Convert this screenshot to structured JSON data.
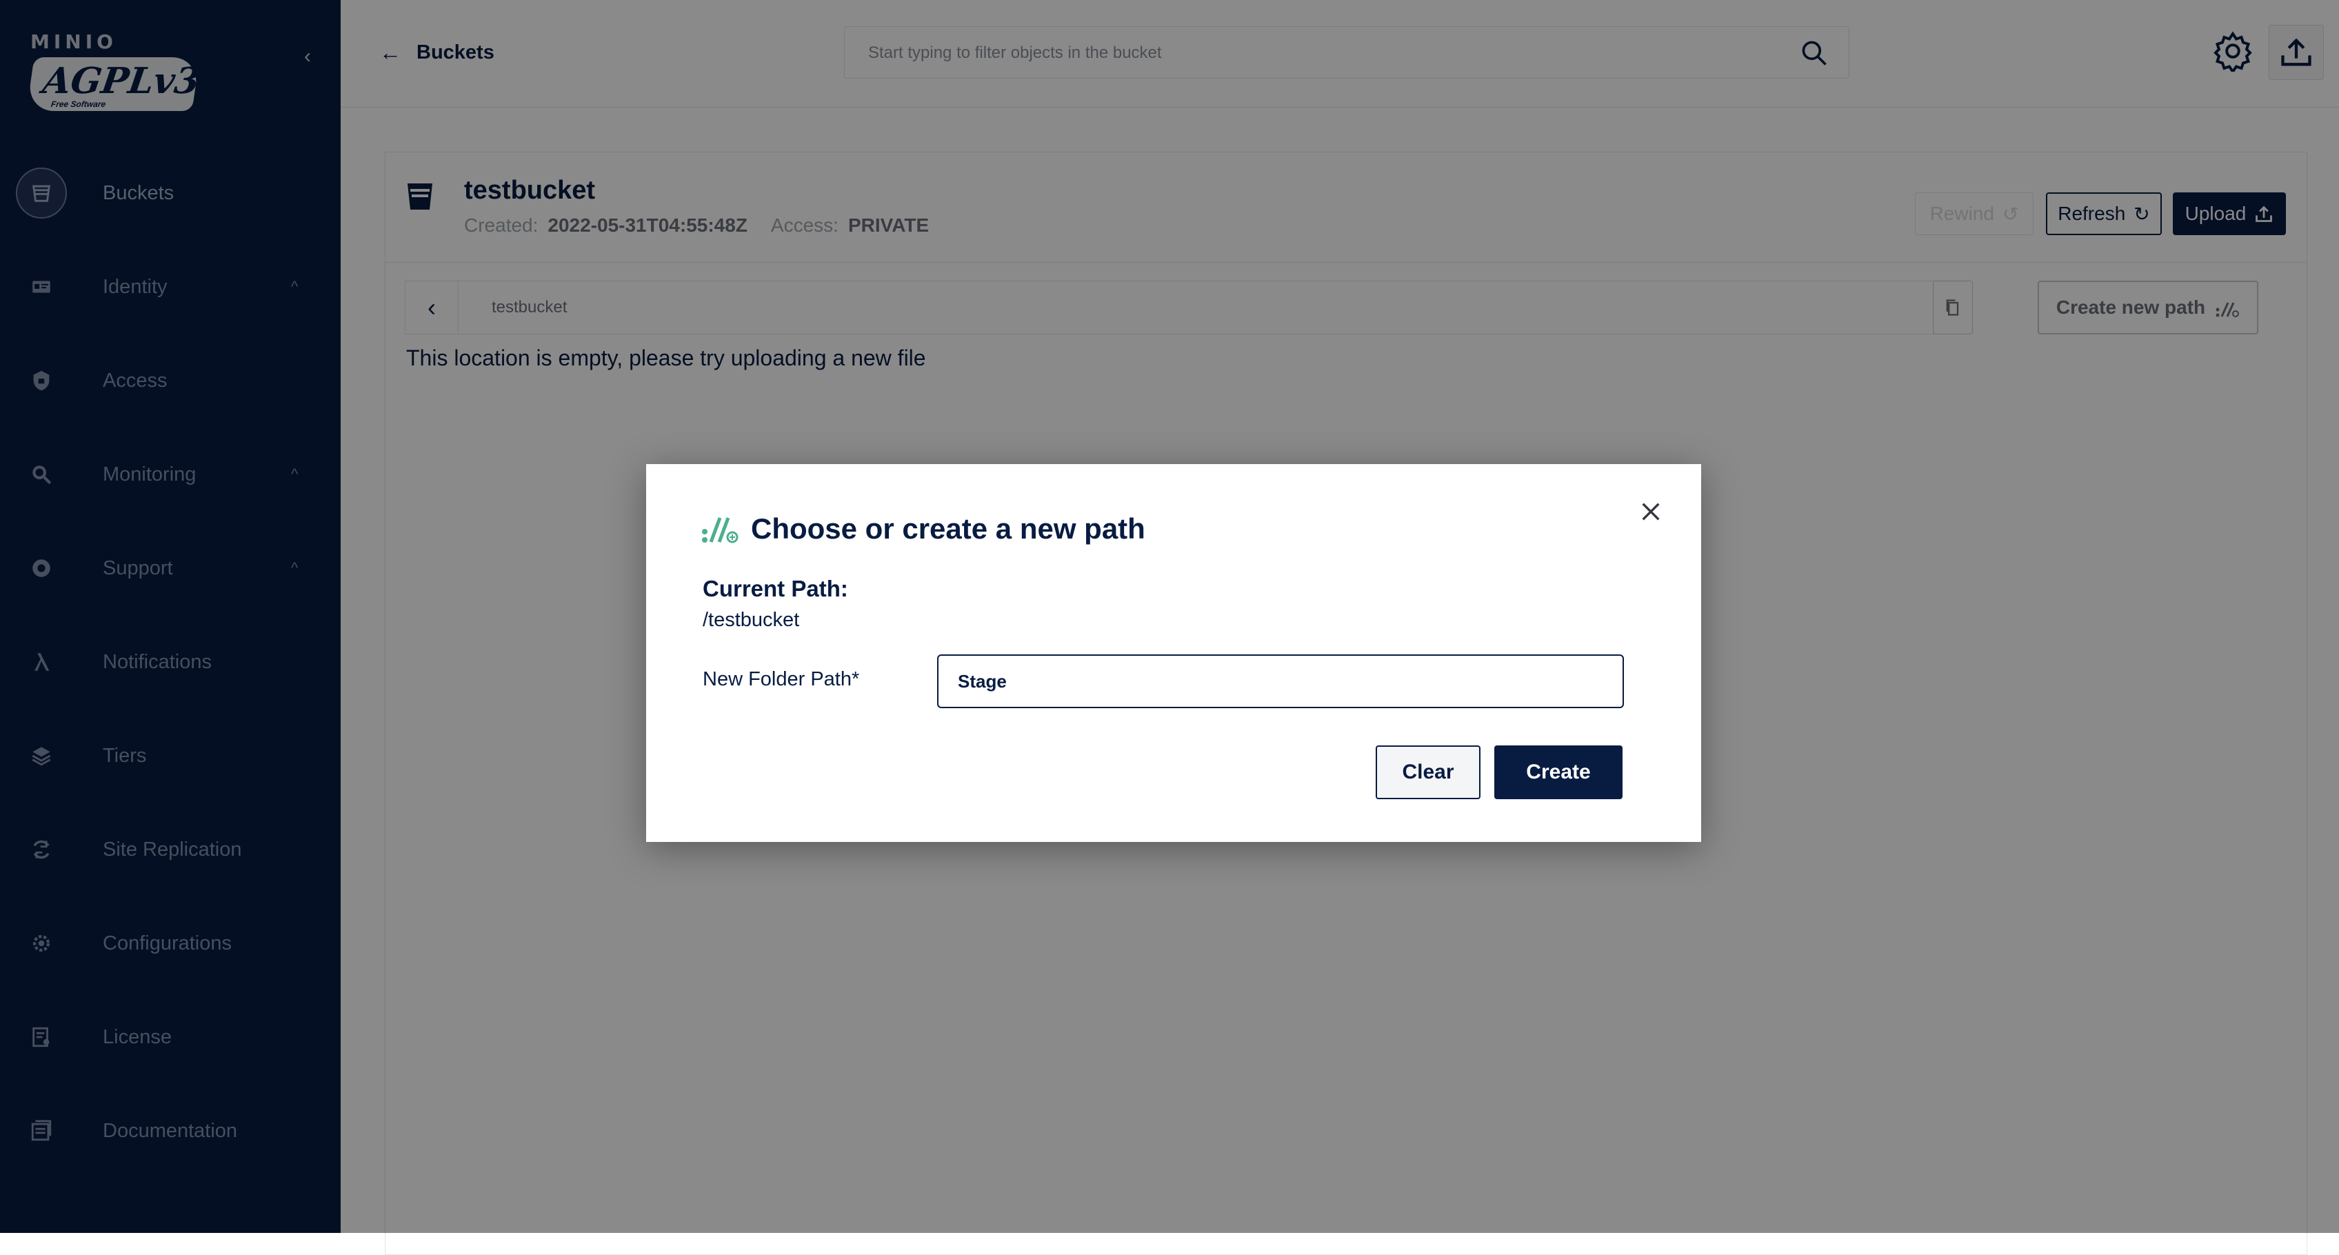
{
  "sidebar": {
    "logo_text": "MINIO",
    "license_badge": "AGPLv3",
    "license_badge_sub": "Free Software",
    "items": [
      {
        "label": "Buckets",
        "icon": "bucket-icon",
        "active": true,
        "caret": false
      },
      {
        "label": "Identity",
        "icon": "identity-icon",
        "caret": true
      },
      {
        "label": "Access",
        "icon": "lock-icon",
        "caret": false
      },
      {
        "label": "Monitoring",
        "icon": "monitoring-icon",
        "caret": true
      },
      {
        "label": "Support",
        "icon": "support-icon",
        "caret": true
      },
      {
        "label": "Notifications",
        "icon": "lambda-icon",
        "caret": false
      },
      {
        "label": "Tiers",
        "icon": "tiers-icon",
        "caret": false
      },
      {
        "label": "Site Replication",
        "icon": "replication-icon",
        "caret": false
      },
      {
        "label": "Configurations",
        "icon": "gear-icon",
        "caret": false
      },
      {
        "label": "License",
        "icon": "license-icon",
        "caret": false
      },
      {
        "label": "Documentation",
        "icon": "documentation-icon",
        "caret": false
      }
    ],
    "caret_glyph": "^"
  },
  "header": {
    "back_label": "Buckets",
    "search_placeholder": "Start typing to filter objects in the bucket"
  },
  "bucket": {
    "name": "testbucket",
    "created_label": "Created:",
    "created_value": "2022-05-31T04:55:48Z",
    "access_label": "Access:",
    "access_value": "PRIVATE",
    "rewind_label": "Rewind",
    "refresh_label": "Refresh",
    "upload_label": "Upload"
  },
  "pathbar": {
    "path": "testbucket",
    "new_path_label": "Create new path"
  },
  "empty_message": "This location is empty, please try uploading a new file",
  "modal": {
    "title": "Choose or create a new path",
    "current_path_label": "Current Path:",
    "current_path_value": "/testbucket",
    "folder_label": "New Folder Path*",
    "folder_value": "Stage",
    "clear_label": "Clear",
    "create_label": "Create"
  },
  "colors": {
    "navy": "#081c42",
    "accent_green": "#4caf8c"
  }
}
